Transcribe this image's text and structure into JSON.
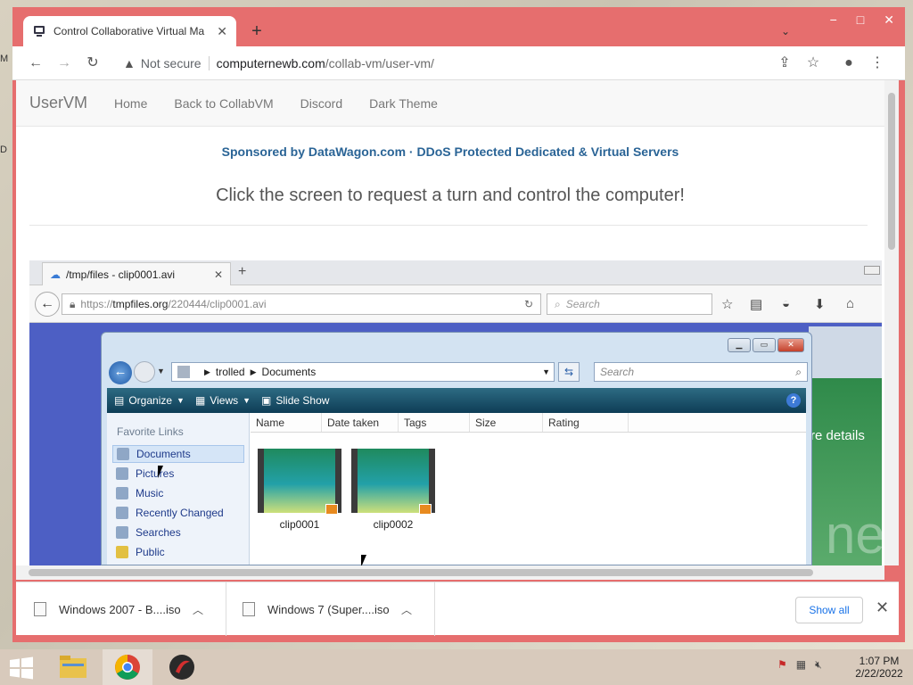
{
  "desktop": {
    "left_label_1": "M",
    "left_label_2": "D"
  },
  "browser": {
    "tab_title": "Control Collaborative Virtual Ma",
    "window_controls": {
      "minimize": "−",
      "maximize": "□",
      "close": "✕"
    },
    "security_label": "Not secure",
    "url_host": "computernewb.com",
    "url_path": "/collab-vm/user-vm/"
  },
  "site": {
    "brand": "UserVM",
    "nav": [
      "Home",
      "Back to CollabVM",
      "Discord",
      "Dark Theme"
    ],
    "sponsor": "Sponsored by DataWagon.com · DDoS Protected Dedicated & Virtual Servers",
    "instruction": "Click the screen to request a turn and control the computer!"
  },
  "vm": {
    "firefox": {
      "tab_title": "/tmp/files - clip0001.avi",
      "url_prefix": "https://",
      "url_host": "tmpfiles.org",
      "url_path": "/220444/clip0001.avi",
      "search_placeholder": "Search"
    },
    "background_text": "re details",
    "background_big": "ne",
    "explorer": {
      "breadcrumb": [
        "trolled",
        "Documents"
      ],
      "search_placeholder": "Search",
      "commands": [
        "Organize",
        "Views",
        "Slide Show"
      ],
      "help": "?",
      "favorites_title": "Favorite Links",
      "favorites": [
        "Documents",
        "Pictures",
        "Music",
        "Recently Changed",
        "Searches",
        "Public"
      ],
      "selected_favorite": "Documents",
      "columns": [
        "Name",
        "Date taken",
        "Tags",
        "Size",
        "Rating"
      ],
      "files": [
        "clip0001",
        "clip0002"
      ]
    }
  },
  "downloads": {
    "items": [
      "Windows 2007 - B....iso",
      "Windows 7 (Super....iso"
    ],
    "show_all": "Show all"
  },
  "taskbar": {
    "time": "1:07 PM",
    "date": "2/22/2022"
  }
}
